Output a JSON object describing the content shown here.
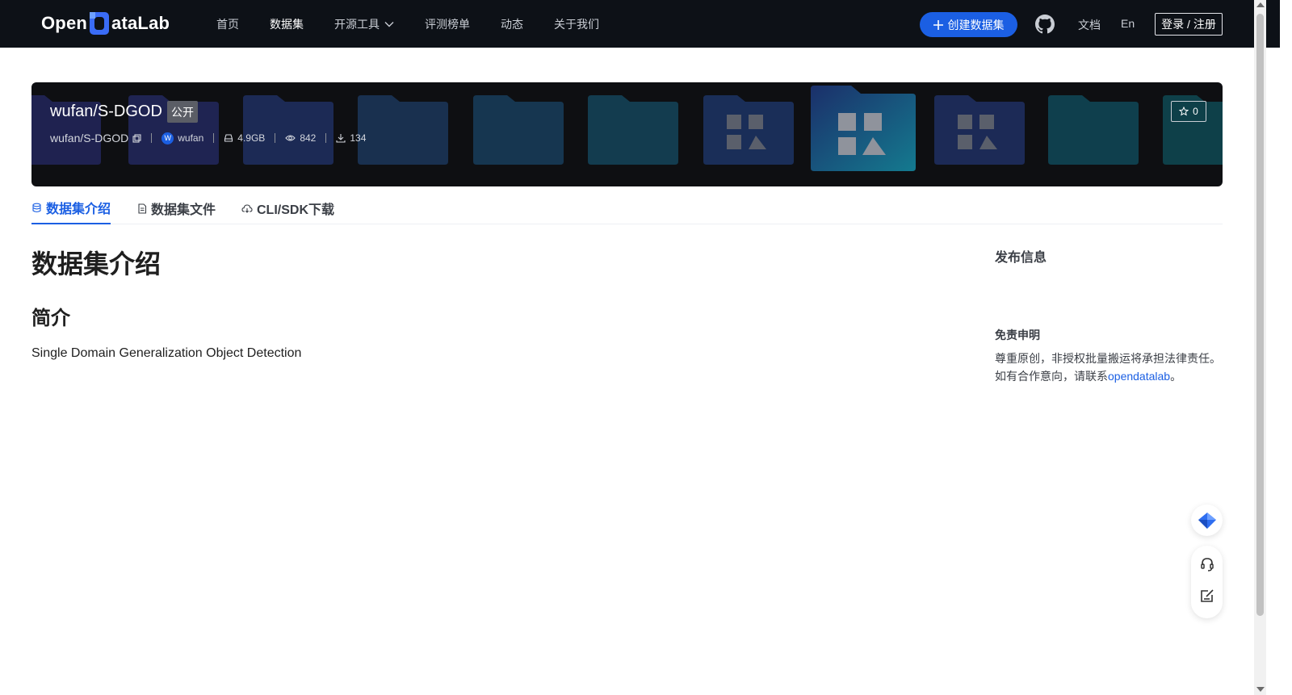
{
  "header": {
    "logo_text_left": "Open",
    "logo_text_right": "ataLab",
    "nav": [
      {
        "label": "首页"
      },
      {
        "label": "数据集"
      },
      {
        "label": "开源工具"
      },
      {
        "label": "评测榜单"
      },
      {
        "label": "动态"
      },
      {
        "label": "关于我们"
      }
    ],
    "create_button": "创建数据集",
    "docs": "文档",
    "lang": "En",
    "login": "登录 / 注册"
  },
  "dataset": {
    "title": "wufan/S-DGOD",
    "visibility": "公开",
    "repo_path": "wufan/S-DGOD",
    "author_initial": "W",
    "author": "wufan",
    "size": "4.9GB",
    "views": "842",
    "downloads": "134",
    "stars": "0"
  },
  "tabs": [
    {
      "label": "数据集介绍",
      "icon": "database-icon"
    },
    {
      "label": "数据集文件",
      "icon": "file-icon"
    },
    {
      "label": "CLI/SDK下载",
      "icon": "cloud-download-icon"
    }
  ],
  "main": {
    "heading": "数据集介绍",
    "subheading": "简介",
    "description": "Single Domain Generalization Object Detection"
  },
  "sidebar": {
    "publish_title": "发布信息",
    "disclaimer_title": "免责申明",
    "disclaimer_line1": "尊重原创，非授权批量搬运将承担法律责任。",
    "disclaimer_line2_prefix": "如有合作意向，请联系",
    "disclaimer_link": "opendatalab",
    "disclaimer_line2_suffix": "。"
  },
  "colors": {
    "nav_bg": "#0d1117",
    "accent": "#1b5fe3",
    "banner_bg": "#0e0f12"
  }
}
